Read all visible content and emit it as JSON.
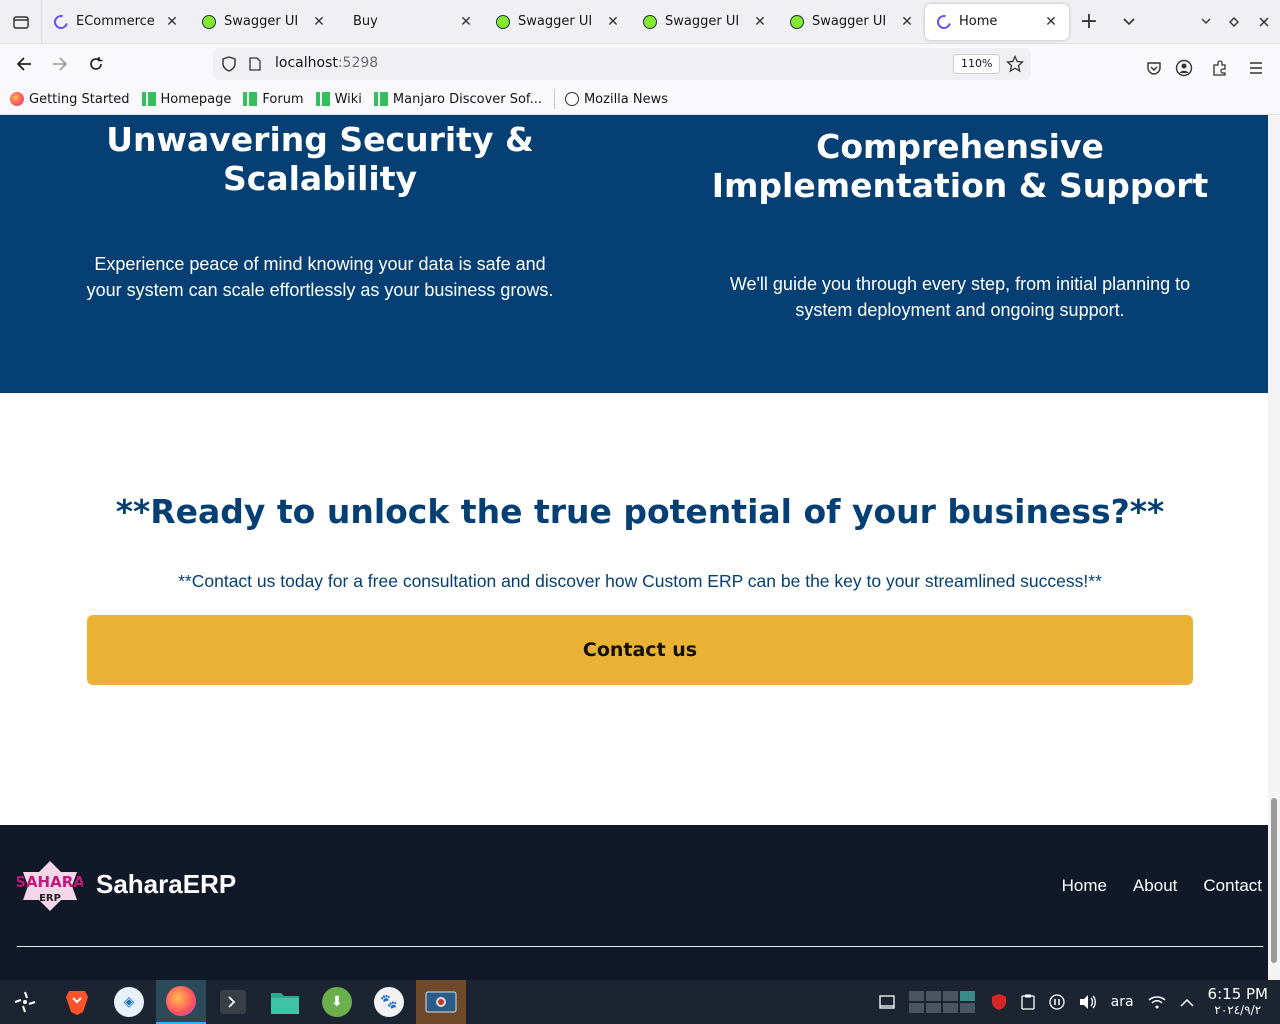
{
  "browser": {
    "tabs": [
      {
        "label": "ECommerce",
        "favicon": "ecommerce-icon",
        "active": false
      },
      {
        "label": "Swagger UI",
        "favicon": "swagger-icon",
        "active": false
      },
      {
        "label": "Buy",
        "favicon": "none",
        "active": false
      },
      {
        "label": "Swagger UI",
        "favicon": "swagger-icon",
        "active": false
      },
      {
        "label": "Swagger UI",
        "favicon": "swagger-icon",
        "active": false
      },
      {
        "label": "Swagger UI",
        "favicon": "swagger-icon",
        "active": false
      },
      {
        "label": "Home",
        "favicon": "ecommerce-icon",
        "active": true
      }
    ],
    "close_glyph": "✕",
    "new_tab_glyph": "+",
    "url": {
      "host": "localhost",
      "port": ":5298"
    },
    "zoom": "110%",
    "bookmarks": [
      {
        "label": "Getting Started",
        "icon": "firefox-icon"
      },
      {
        "label": "Homepage",
        "icon": "manjaro-icon"
      },
      {
        "label": "Forum",
        "icon": "manjaro-icon"
      },
      {
        "label": "Wiki",
        "icon": "manjaro-icon"
      },
      {
        "label": "Manjaro Discover Sof...",
        "icon": "manjaro-icon"
      },
      {
        "label": "Mozilla News",
        "icon": "globe-icon"
      }
    ]
  },
  "page": {
    "features": {
      "left": {
        "title": "Unwavering Security & Scalability",
        "body": "Experience peace of mind knowing your data is safe and your system can scale effortlessly as your business grows."
      },
      "right": {
        "title": "Comprehensive Implementation & Support",
        "body": "We'll guide you through every step, from initial planning to system deployment and ongoing support."
      }
    },
    "cta": {
      "title": "**Ready to unlock the true potential of your business?**",
      "subtitle": "**Contact us today for a free consultation and discover how Custom ERP can be the key to your streamlined success!**",
      "button": "Contact us"
    },
    "footer": {
      "brand": "SaharaERP",
      "logo_top": "SAHARA",
      "logo_bottom": "ERP",
      "links": [
        "Home",
        "About",
        "Contact"
      ]
    }
  },
  "taskbar": {
    "keyboard_layout": "ara",
    "time": "6:15 PM",
    "date": "٢٠٢٤/٩/٢"
  },
  "colors": {
    "primary_blue": "#053f73",
    "accent_yellow": "#e9b234",
    "footer_bg": "#111827"
  }
}
